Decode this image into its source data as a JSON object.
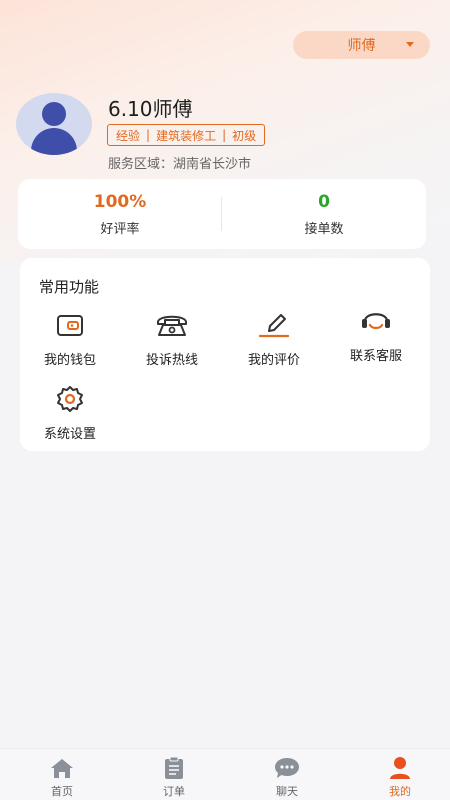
{
  "header": {
    "role_selector": "师傅"
  },
  "profile": {
    "name": "6.10师傅",
    "tags": [
      "经验",
      "建筑装修工",
      "初级"
    ],
    "service_area": "服务区域：湖南省长沙市"
  },
  "stats": [
    {
      "value": "100%",
      "label": "好评率",
      "color": "#e06a20"
    },
    {
      "value": "0",
      "label": "接单数",
      "color": "#2aa52a"
    }
  ],
  "functions": {
    "title": "常用功能",
    "items": [
      {
        "label": "我的钱包",
        "icon": "wallet-icon"
      },
      {
        "label": "投诉热线",
        "icon": "telephone-icon"
      },
      {
        "label": "我的评价",
        "icon": "pen-icon"
      },
      {
        "label": "联系客服",
        "icon": "headset-icon"
      },
      {
        "label": "系统设置",
        "icon": "gear-icon"
      }
    ]
  },
  "tabbar": {
    "active": "我的",
    "accent_color": "#e06a20",
    "items": [
      {
        "label": "首页",
        "icon": "home-icon"
      },
      {
        "label": "订单",
        "icon": "clipboard-icon"
      },
      {
        "label": "聊天",
        "icon": "chat-icon"
      },
      {
        "label": "我的",
        "icon": "person-icon"
      }
    ]
  }
}
